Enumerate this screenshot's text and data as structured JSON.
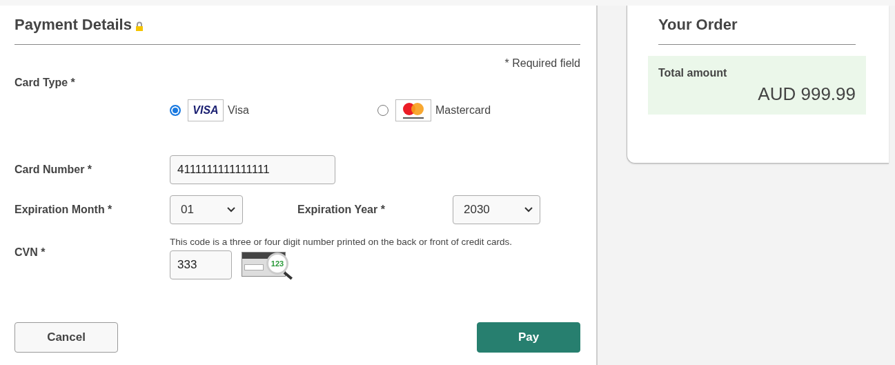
{
  "payment": {
    "title": "Payment Details",
    "required_note": "* Required field",
    "card_type": {
      "label": "Card Type *",
      "options": [
        {
          "kind": "visa",
          "logo_text": "VISA",
          "label": "Visa",
          "selected": true
        },
        {
          "kind": "mastercard",
          "label": "Mastercard",
          "selected": false
        }
      ]
    },
    "card_number": {
      "label": "Card Number *",
      "value": "4111111111111111"
    },
    "expiration_month": {
      "label": "Expiration Month *",
      "value": "01"
    },
    "expiration_year": {
      "label": "Expiration Year *",
      "value": "2030"
    },
    "cvn": {
      "label": "CVN *",
      "hint": "This code is a three or four digit number printed on the back or front of credit cards.",
      "value": "333",
      "icon_code": "123"
    },
    "buttons": {
      "cancel": "Cancel",
      "pay": "Pay"
    }
  },
  "order": {
    "title": "Your Order",
    "total_label": "Total amount",
    "total_value": "AUD 999.99"
  }
}
